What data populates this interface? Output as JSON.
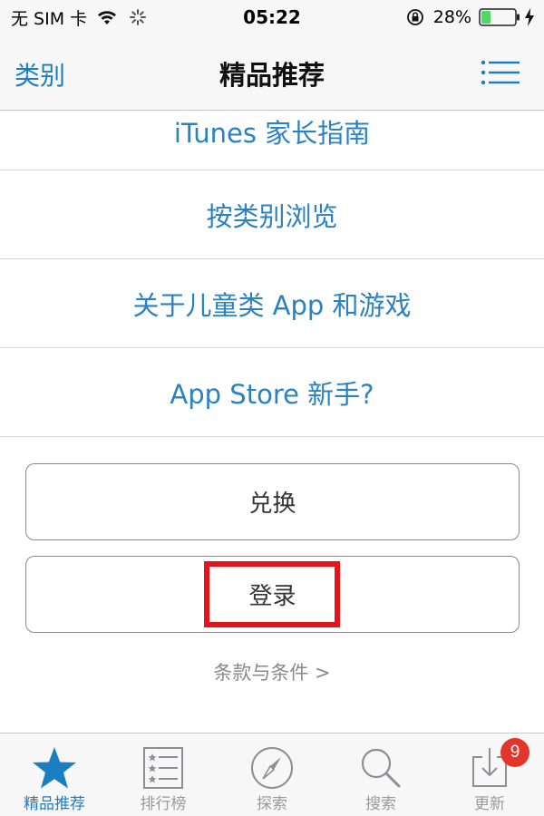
{
  "status_bar": {
    "carrier": "无 SIM 卡",
    "time": "05:22",
    "battery_percent": "28%",
    "battery_level": 0.28
  },
  "nav": {
    "back_label": "类别",
    "title": "精品推荐",
    "menu_icon": "list-icon"
  },
  "list_items": [
    {
      "label": "iTunes 家长指南"
    },
    {
      "label": "按类别浏览"
    },
    {
      "label": "关于儿童类 App 和游戏"
    },
    {
      "label": "App Store 新手?"
    }
  ],
  "buttons": {
    "redeem": "兑换",
    "login": "登录"
  },
  "terms_link": "条款与条件 >",
  "tabs": [
    {
      "label": "精品推荐",
      "icon": "star-icon",
      "active": true
    },
    {
      "label": "排行榜",
      "icon": "list-icon",
      "active": false
    },
    {
      "label": "探索",
      "icon": "compass-icon",
      "active": false
    },
    {
      "label": "搜索",
      "icon": "search-icon",
      "active": false
    },
    {
      "label": "更新",
      "icon": "download-icon",
      "active": false
    }
  ],
  "updates_badge": "9",
  "colors": {
    "accent": "#1a7fc1",
    "link_text": "#2a82c0",
    "highlight": "#e3141b",
    "badge": "#e5352b"
  }
}
